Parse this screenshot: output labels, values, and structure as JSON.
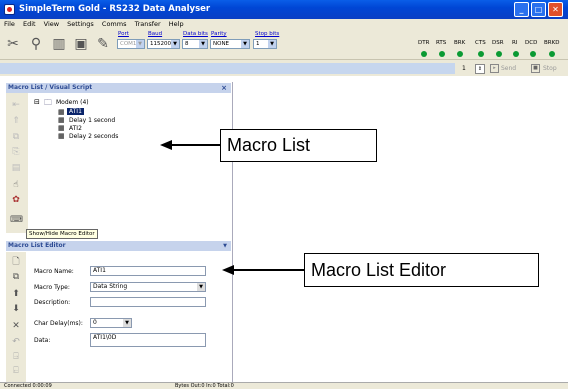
{
  "window": {
    "title": "SimpleTerm Gold - RS232 Data Analyser"
  },
  "menu": [
    "File",
    "Edit",
    "View",
    "Settings",
    "Comms",
    "Transfer",
    "Help"
  ],
  "toolbar": {
    "labels": {
      "port": "Port",
      "baud": "Baud",
      "databits": "Data bits",
      "parity": "Parity",
      "stopbits": "Stop bits"
    },
    "values": {
      "port": "COM1",
      "baud": "115200",
      "databits": "8",
      "parity": "NONE",
      "stopbits": "1"
    },
    "signals": [
      "DTR",
      "RTS",
      "BRK",
      "CTS",
      "DSR",
      "RI",
      "DCD",
      "BRKD"
    ]
  },
  "sendbar": {
    "count": "1",
    "send": "Send",
    "stop": "Stop"
  },
  "macro_list": {
    "title": "Macro List / Visual Script",
    "root": "Modem (4)",
    "items": [
      "ATI1",
      "Delay 1 second",
      "ATI2",
      "Delay 2 seconds"
    ],
    "tooltip": "Show/Hide Macro Editor"
  },
  "macro_editor": {
    "title": "Macro List Editor",
    "fields": {
      "name_label": "Macro Name:",
      "name_value": "ATI1",
      "type_label": "Macro Type:",
      "type_value": "Data String",
      "desc_label": "Description:",
      "desc_value": "",
      "delay_label": "Char Delay(ms):",
      "delay_value": "0",
      "data_label": "Data:",
      "data_value": "ATI1\\0D"
    }
  },
  "callouts": {
    "list": "Macro List",
    "editor": "Macro List Editor"
  },
  "status": {
    "connection": "Connected 0:00:09",
    "bytes": "Bytes Out:0  In:0  Total:0"
  }
}
